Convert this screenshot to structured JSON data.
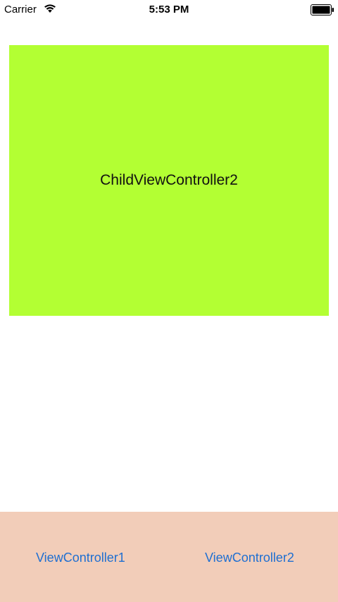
{
  "status_bar": {
    "carrier": "Carrier",
    "time": "5:53 PM",
    "wifi_icon": "wifi-icon",
    "battery_icon": "battery-icon"
  },
  "child_view": {
    "label": "ChildViewController2",
    "background_color": "#b3ff33"
  },
  "bottom_bar": {
    "background_color": "#f2cdb9",
    "buttons": [
      {
        "label": "ViewController1"
      },
      {
        "label": "ViewController2"
      }
    ],
    "button_color": "#1f6fd1"
  }
}
